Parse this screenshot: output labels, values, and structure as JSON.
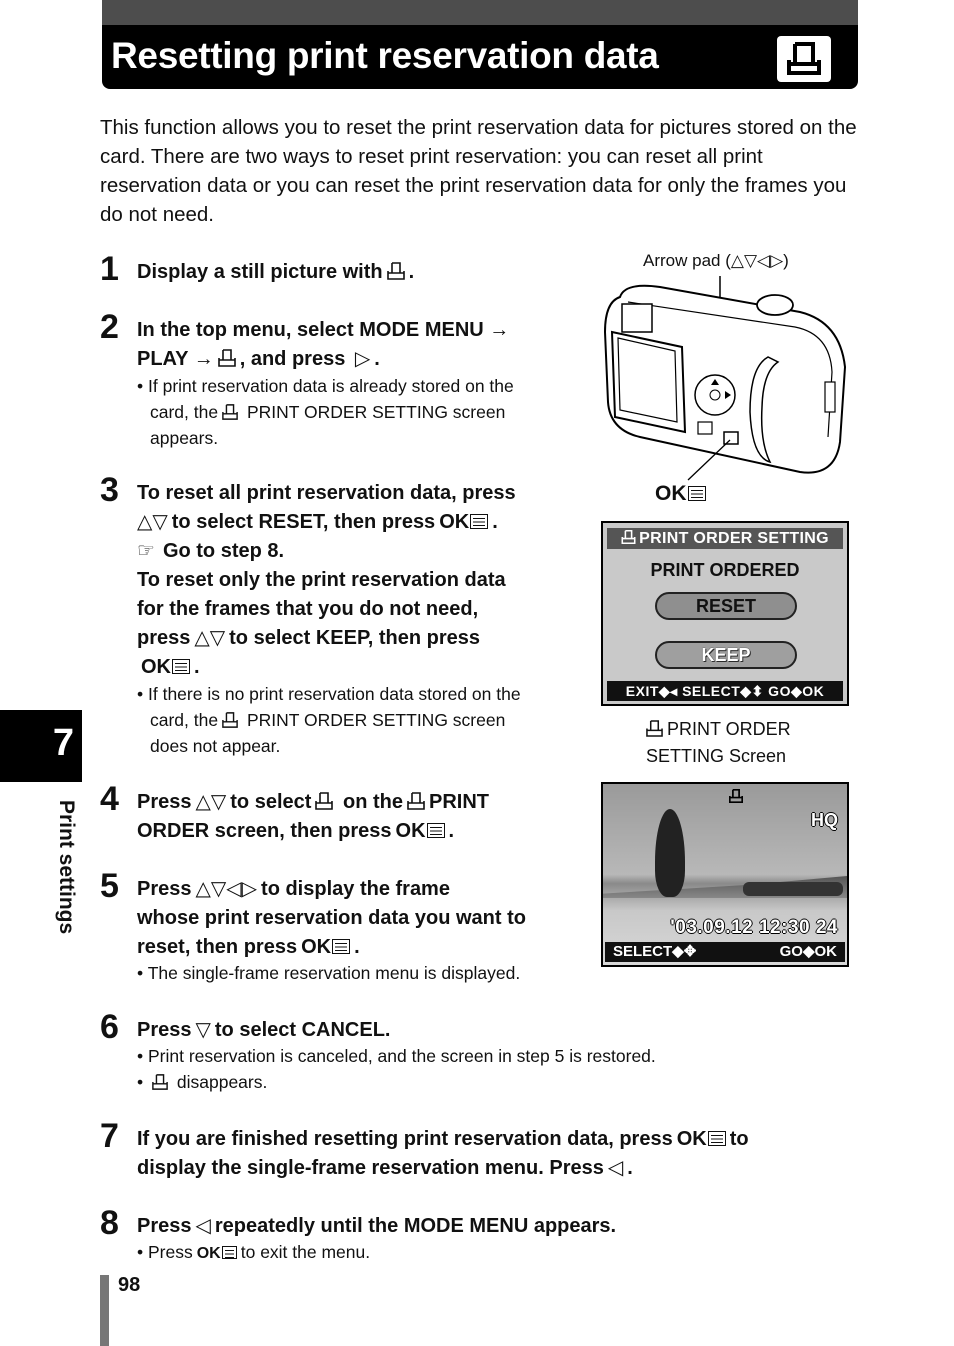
{
  "header": {
    "title": "Resetting print reservation data",
    "icon": "print-order-icon"
  },
  "intro": "This function allows you to reset the print reservation data for pictures stored on the card. There are two ways to reset print reservation: you can reset all print reservation data or you can reset the print reservation data for only the frames you do not need.",
  "side_tab": {
    "chapter": "7",
    "label": "Print settings"
  },
  "symbols": {
    "up_down": "△▽",
    "four_way": "△▽◁▷",
    "left": "◁",
    "right": "▷",
    "down": "▽",
    "arrow": "→",
    "ok": "OK",
    "ref": "☞"
  },
  "steps": [
    {
      "num": "1",
      "lines": [
        "Display a still picture with",
        "."
      ]
    },
    {
      "num": "2",
      "lines": [
        "In the top menu, select MODE MENU",
        "PLAY",
        ", and press",
        "."
      ],
      "bullets": [
        "If print reservation data is already stored on the",
        "card, the",
        "PRINT ORDER SETTING screen",
        "appears."
      ]
    },
    {
      "num": "3",
      "lines": [
        "To reset all print reservation data, press",
        "to select RESET, then press",
        "Go to step 8.",
        "To reset only the print reservation data",
        "for the frames that you do not need,",
        "press",
        "to select KEEP, then press"
      ],
      "bullets": [
        "If there is no print reservation data stored on the",
        "card, the",
        "PRINT ORDER SETTING screen",
        "does not appear."
      ]
    },
    {
      "num": "4",
      "lines": [
        "Press",
        "to select",
        "on the",
        "PRINT",
        "ORDER screen, then press"
      ]
    },
    {
      "num": "5",
      "lines": [
        "Press",
        "to display the frame",
        "whose print reservation data you want to",
        "reset, then press"
      ],
      "bullets": [
        "The single-frame reservation menu is displayed."
      ]
    },
    {
      "num": "6",
      "lines": [
        "Press",
        "to select CANCEL."
      ],
      "bullets": [
        "Print reservation is canceled, and the screen in step 5 is restored.",
        "disappears."
      ]
    },
    {
      "num": "7",
      "lines": [
        "If you are finished resetting print reservation data, press",
        "to",
        "display the single-frame reservation menu. Press"
      ]
    },
    {
      "num": "8",
      "lines": [
        "Press",
        "repeatedly until the MODE MENU appears."
      ],
      "bullets": [
        "Press",
        "to exit the menu."
      ]
    }
  ],
  "camera_figure": {
    "caption": "Arrow pad (△▽◁▷)",
    "ok_label": "OK"
  },
  "print_order_screen": {
    "title": "PRINT ORDER SETTING",
    "subtitle": "PRINT ORDERED",
    "options": [
      "RESET",
      "KEEP"
    ],
    "selected": "RESET",
    "footer": "EXIT◆◂ SELECT◆⬍ GO◆OK",
    "caption_line1": "PRINT ORDER",
    "caption_line2": "SETTING Screen"
  },
  "photo_screen": {
    "quality": "HQ",
    "datetime": "'03.09.12  12:30  24",
    "footer_left": "SELECT◆✥",
    "footer_right": "GO◆OK"
  },
  "page_number": "98"
}
